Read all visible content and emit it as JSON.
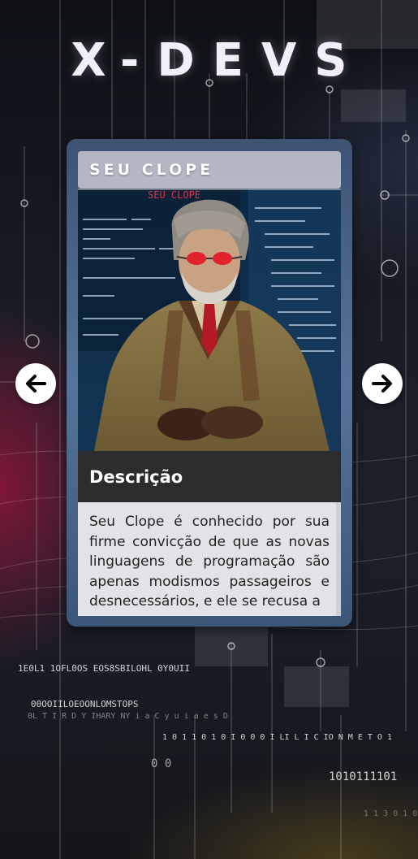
{
  "app": {
    "logo_text": "X-DEVS"
  },
  "navigation": {
    "prev_icon": "arrow-left-icon",
    "next_icon": "arrow-right-icon"
  },
  "card": {
    "name": "SEU CLOPE",
    "portrait_banner": "SEU CLOPE",
    "description_heading": "Descrição",
    "description": "Seu Clope é conhecido por sua firme convicção de que as novas linguagens de programação são apenas modismos passageiros e desnecessários, e ele se recusa a"
  },
  "background_code": {
    "line1": "1E0L1 1OFL0OS EOS8SBILOHL 0Y0UII",
    "line2": "00OOIILOEOONLOMSTOPS",
    "line3": "0L T I R  D Y IHARY NY  i a C y u i a e s D",
    "line4": "1 0 1 1   0 1 0 I 0 0 0 I LI L I C IO N M E T O 1",
    "line5": "0    0",
    "line6": "1010111101",
    "line7": "1 1 3 0 1 0 0 0"
  },
  "colors": {
    "accent_red": "#a3123e",
    "card_blue": "#4a6a92",
    "header_dark": "#2c2c2e"
  }
}
